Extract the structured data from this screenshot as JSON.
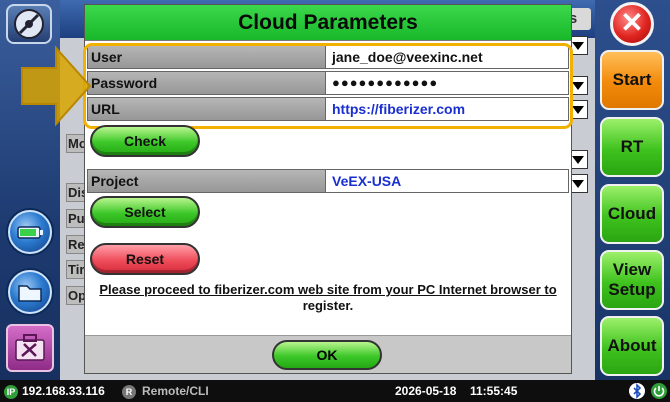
{
  "dialog": {
    "title": "Cloud Parameters",
    "fields": [
      {
        "label": "User",
        "value": "jane_doe@veexinc.net"
      },
      {
        "label": "Password",
        "value": "●●●●●●●●●●●●"
      },
      {
        "label": "URL",
        "value": "https://fiberizer.com"
      }
    ],
    "check_label": "Check",
    "project": {
      "label": "Project",
      "value": "VeEX-USA"
    },
    "select_label": "Select",
    "reset_label": "Reset",
    "info_line1": "Please proceed to fiberizer.com web site from your PC Internet browser to",
    "info_line2": "register.",
    "ok_label": "OK"
  },
  "background": {
    "header_tab": "s",
    "rows": [
      "Mo",
      "Dis",
      "Pu",
      "Re",
      "Tir",
      "Op"
    ]
  },
  "right_bar": {
    "close_glyph": "✕",
    "buttons": [
      "Start",
      "RT",
      "Cloud",
      "View Setup",
      "About"
    ]
  },
  "status_bar": {
    "ip_badge": "IP",
    "ip": "192.168.33.116",
    "remote_badge": "R",
    "remote": "Remote/CLI",
    "date": "2026-05-18",
    "time": "11:55:45"
  },
  "colors": {
    "dialog_title_bg": "#18b82a",
    "highlight": "#f2b100",
    "link": "#1a2fd0",
    "start_button": "#f28a0a",
    "nav_button": "#3fc21e"
  }
}
